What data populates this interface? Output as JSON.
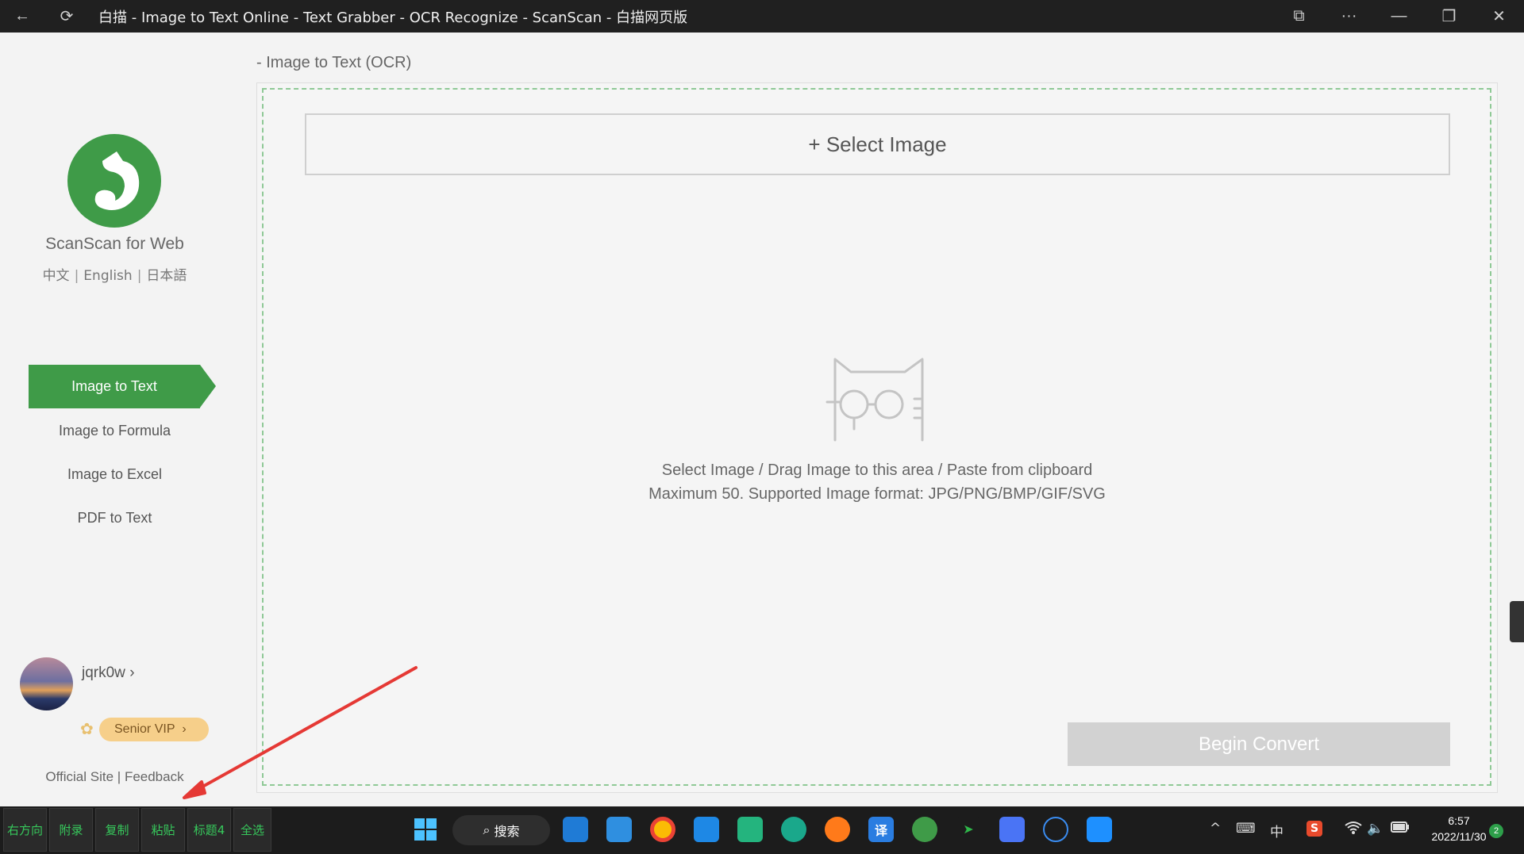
{
  "window": {
    "title": "白描 - Image to Text Online - Text Grabber - OCR Recognize - ScanScan - 白描网页版",
    "back_icon": "←",
    "refresh_icon": "⟳",
    "cast_icon": "⧉",
    "more_icon": "···",
    "minimize_icon": "—",
    "restore_icon": "❐",
    "close_icon": "✕"
  },
  "sidebar": {
    "brand": "ScanScan for Web",
    "languages": [
      "中文",
      "English",
      "日本語"
    ],
    "lang_sep": "|",
    "nav": [
      {
        "label": "Image to Text",
        "active": true
      },
      {
        "label": "Image to Formula",
        "active": false
      },
      {
        "label": "Image to Excel",
        "active": false
      },
      {
        "label": "PDF to Text",
        "active": false
      }
    ],
    "user": {
      "name": "jqrk0w",
      "name_chevron": "›",
      "vip_label": "Senior VIP",
      "vip_chevron": "›"
    },
    "footer": {
      "official_site": "Official Site",
      "sep": "|",
      "feedback": "Feedback"
    }
  },
  "main": {
    "breadcrumb": "- Image to Text (OCR)",
    "select_button": "+ Select Image",
    "hint_line1": "Select Image / Drag Image to this area / Paste from clipboard",
    "hint_line2": "Maximum 50. Supported Image format: JPG/PNG/BMP/GIF/SVG",
    "convert_button": "Begin Convert"
  },
  "taskbar": {
    "quick_buttons": [
      "右方向",
      "附录",
      "复制",
      "粘贴",
      "标题4",
      "全选"
    ],
    "search_label": "搜索",
    "tray": {
      "chevron": "^",
      "keyboard": "⌨",
      "ime": "中",
      "sogou": "S",
      "wifi": "wifi",
      "volume": "🔈",
      "battery": "battery"
    },
    "time": "6:57",
    "date": "2022/11/30",
    "notifications": "2"
  },
  "colors": {
    "brand_green": "#3f9b48",
    "vip_gold": "#f6cf8a",
    "convert_disabled": "#d2d2d2",
    "arrow_red": "#e53935"
  }
}
